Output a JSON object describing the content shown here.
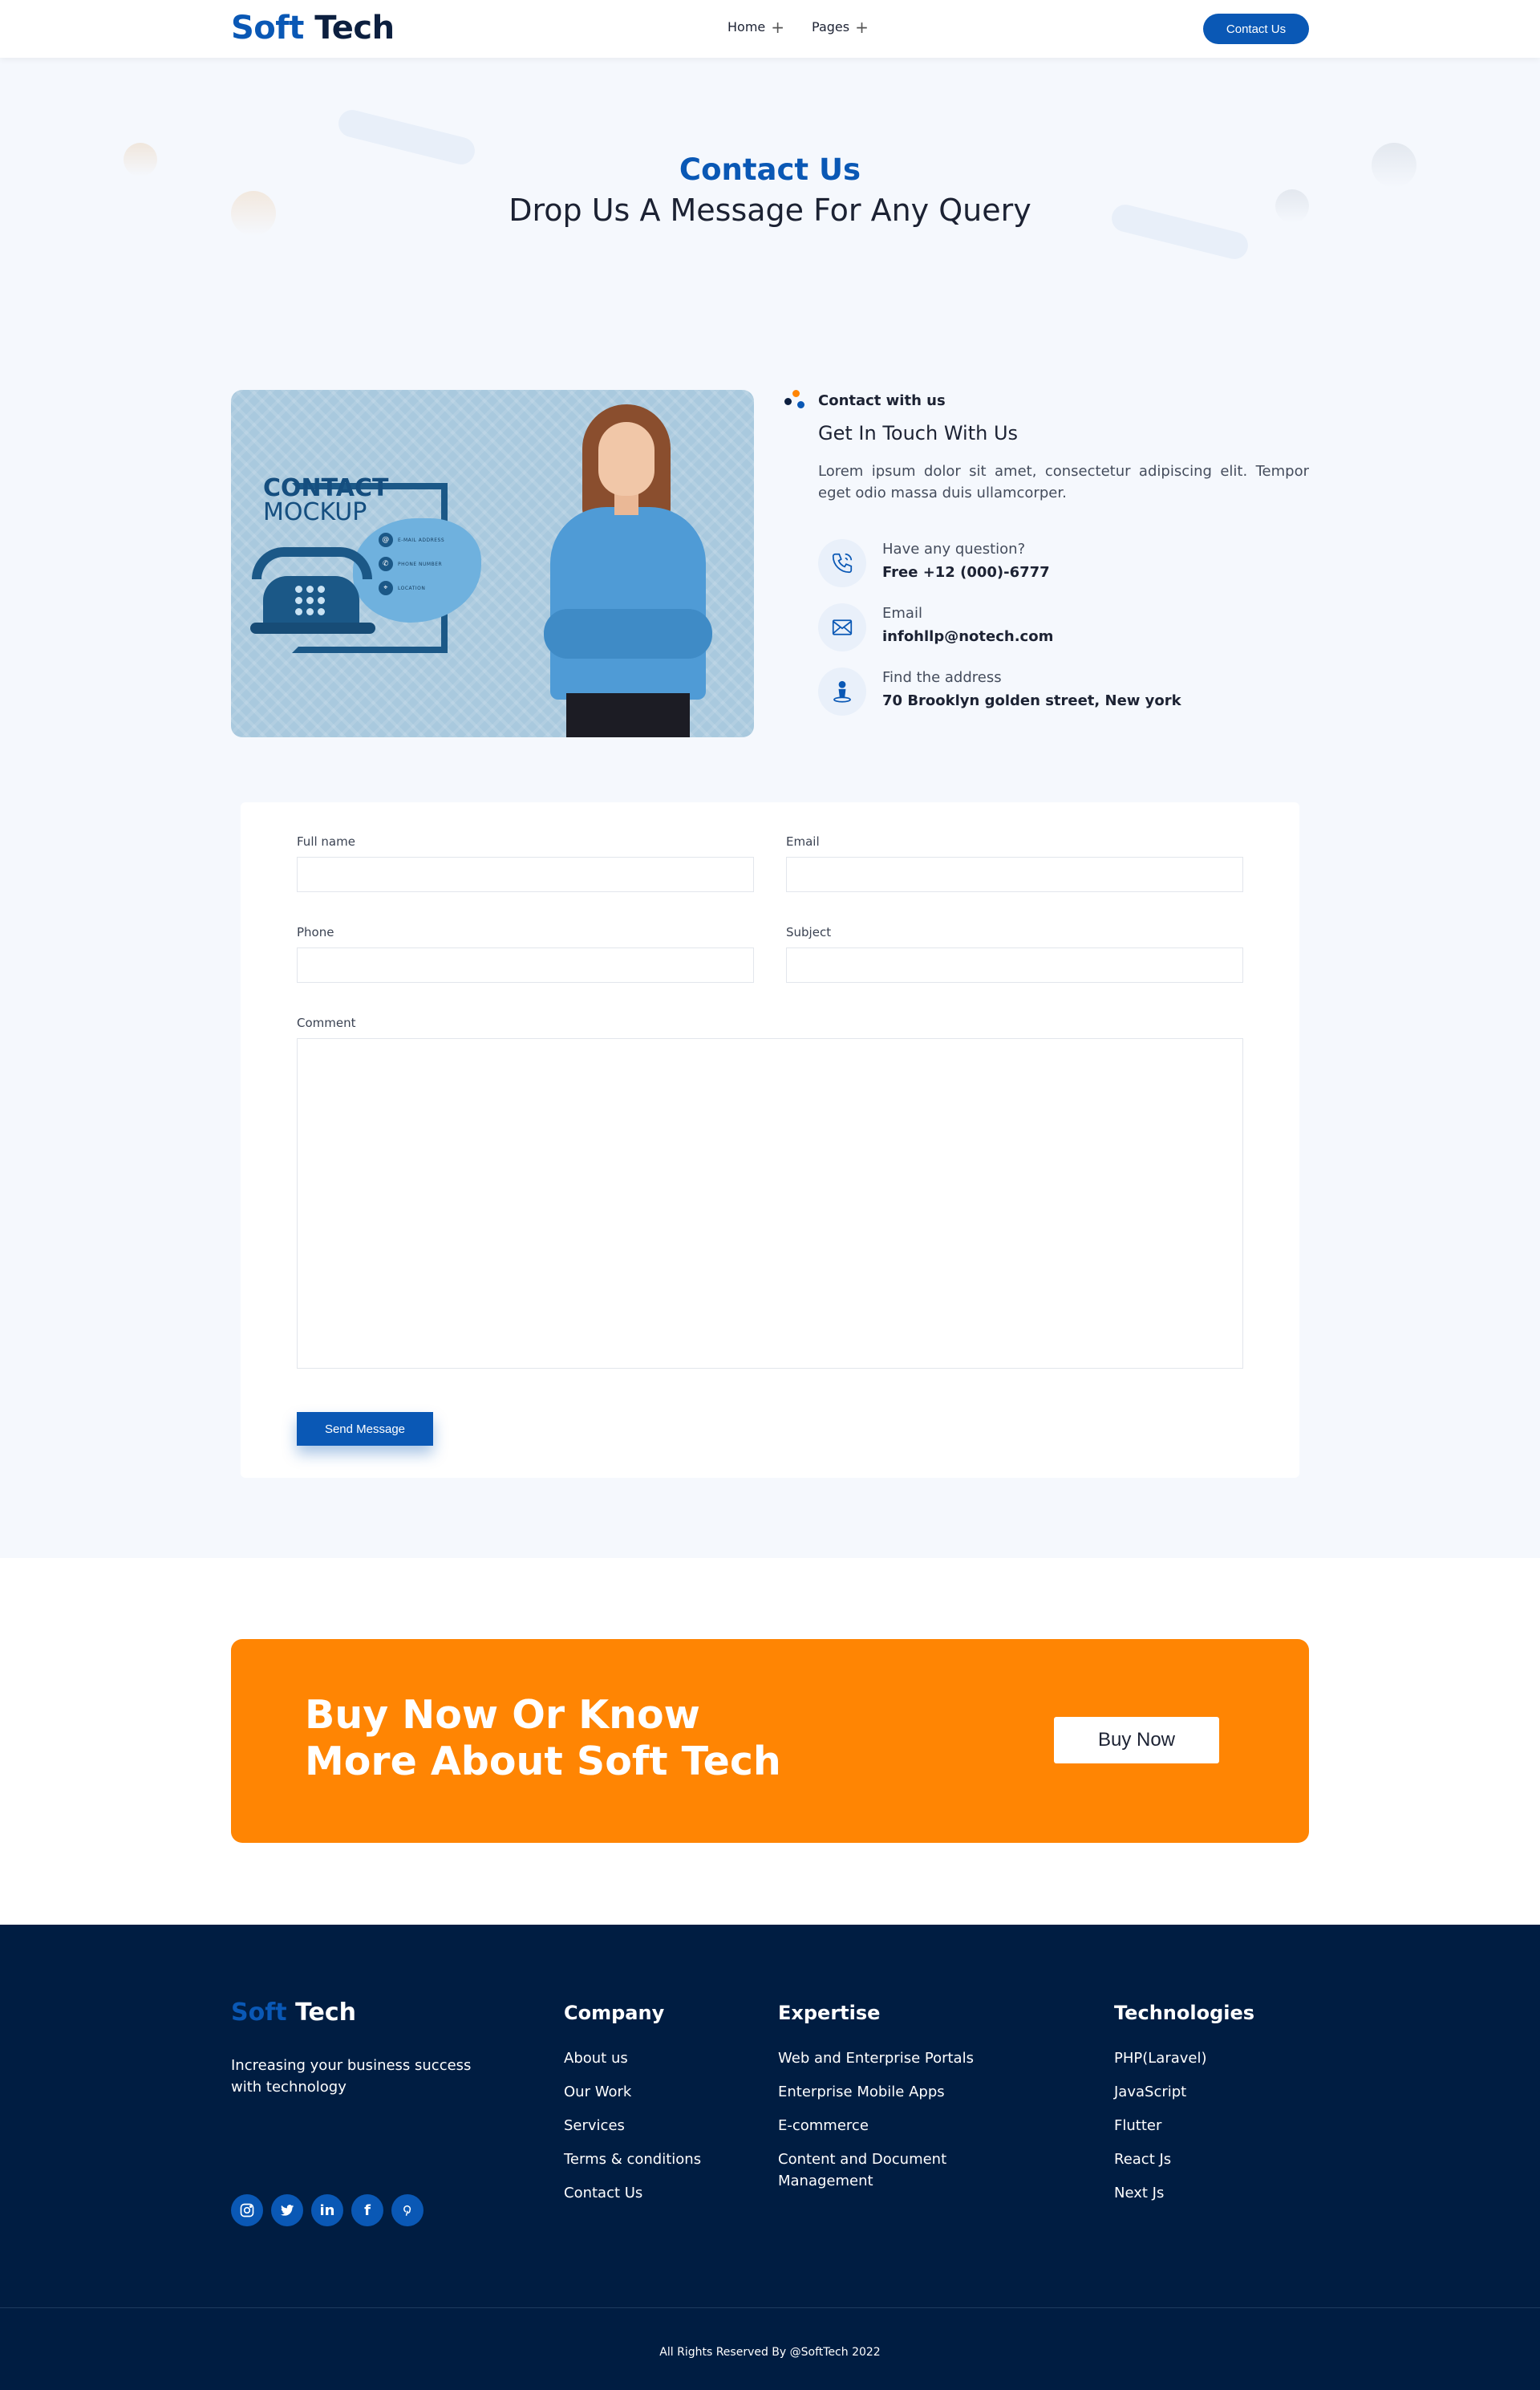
{
  "header": {
    "logo_soft": "Soft",
    "logo_tech": "Tech",
    "nav": [
      {
        "label": "Home"
      },
      {
        "label": "Pages"
      }
    ],
    "cta_label": "Contact Us"
  },
  "hero": {
    "kicker": "Contact Us",
    "title": "Drop Us A Message For Any Query"
  },
  "contact_image": {
    "title": "CONTACT",
    "subtitle": "MOCKUP",
    "lines": [
      "E-MAIL ADDRESS",
      "PHONE NUMBER",
      "LOCATION"
    ]
  },
  "contact_info": {
    "kicker": "Contact with us",
    "title": "Get In Touch With Us",
    "description": "Lorem ipsum dolor sit amet, consectetur adipiscing elit. Tempor eget odio massa duis ullamcorper.",
    "items": [
      {
        "label": "Have any question?",
        "value": "Free +12 (000)-6777",
        "icon": "phone-icon"
      },
      {
        "label": "Email",
        "value": "infohllp@notech.com",
        "icon": "email-icon"
      },
      {
        "label": "Find the address",
        "value": "70 Brooklyn golden street, New york",
        "icon": "location-icon"
      }
    ]
  },
  "form": {
    "full_name_label": "Full name",
    "full_name_value": "",
    "email_label": "Email",
    "email_value": "",
    "phone_label": "Phone",
    "phone_value": "",
    "subject_label": "Subject",
    "subject_value": "",
    "comment_label": "Comment",
    "comment_value": "",
    "submit_label": "Send Message"
  },
  "cta": {
    "title": "Buy Now Or Know More About Soft Tech",
    "button_label": "Buy Now"
  },
  "footer": {
    "logo_soft": "Soft",
    "logo_tech": "Tech",
    "tagline": "Increasing your business success with technology",
    "social": [
      "instagram-icon",
      "twitter-icon",
      "linkedin-icon",
      "facebook-icon",
      "pinterest-icon"
    ],
    "columns": [
      {
        "title": "Company",
        "items": [
          "About us",
          "Our Work",
          "Services",
          "Terms & conditions",
          "Contact Us"
        ]
      },
      {
        "title": "Expertise",
        "items": [
          "Web and Enterprise Portals",
          "Enterprise Mobile Apps",
          "E-commerce",
          "Content and Document Management"
        ]
      },
      {
        "title": "Technologies",
        "items": [
          "PHP(Laravel)",
          "JavaScript",
          "Flutter",
          "React Js",
          "Next Js"
        ]
      }
    ],
    "copyright": "All Rights Reserved By @SoftTech 2022"
  },
  "colors": {
    "brand_blue": "#0a58b5",
    "cta_orange": "#ff8503",
    "footer_navy": "#001d42",
    "section_bg": "#f5f8fd"
  }
}
